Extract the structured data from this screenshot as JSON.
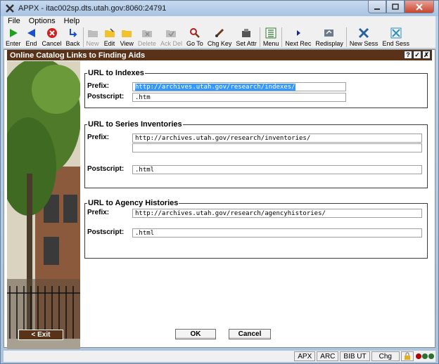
{
  "window": {
    "title": "APPX - itac002sp.dts.utah.gov:8060:24791"
  },
  "menu": [
    "File",
    "Options",
    "Help"
  ],
  "toolbar": {
    "groups": [
      [
        {
          "label": "Enter",
          "icon": "enter-icon",
          "enabled": true
        },
        {
          "label": "End",
          "icon": "end-icon",
          "enabled": true
        },
        {
          "label": "Cancel",
          "icon": "cancel-icon",
          "enabled": true
        },
        {
          "label": "Back",
          "icon": "back-icon",
          "enabled": true
        }
      ],
      [
        {
          "label": "New",
          "icon": "new-folder-icon",
          "enabled": false
        },
        {
          "label": "Edit",
          "icon": "edit-folder-icon",
          "enabled": true
        },
        {
          "label": "View",
          "icon": "view-folder-icon",
          "enabled": true
        },
        {
          "label": "Delete",
          "icon": "delete-folder-icon",
          "enabled": false
        },
        {
          "label": "Ack Del",
          "icon": "ack-delete-icon",
          "enabled": false
        },
        {
          "label": "Go To",
          "icon": "magnifier-icon",
          "enabled": true
        },
        {
          "label": "Chg Key",
          "icon": "change-key-icon",
          "enabled": true
        },
        {
          "label": "Set Attr",
          "icon": "set-attributes-icon",
          "enabled": true
        }
      ],
      [
        {
          "label": "Menu",
          "icon": "menu-icon",
          "enabled": true
        }
      ],
      [
        {
          "label": "Next Rec",
          "icon": "next-record-icon",
          "enabled": true
        },
        {
          "label": "Redisplay",
          "icon": "redisplay-icon",
          "enabled": true
        }
      ],
      [
        {
          "label": "New Sess",
          "icon": "new-session-icon",
          "enabled": true
        },
        {
          "label": "End Sess",
          "icon": "end-session-icon",
          "enabled": true
        }
      ]
    ]
  },
  "form": {
    "title": "Online Catalog Links to Finding Aids",
    "header_buttons": [
      "?",
      "✓",
      "✗"
    ],
    "indexes": {
      "legend": "URL to Indexes",
      "prefix_label": "Prefix:",
      "prefix_value": "http://archives.utah.gov/research/indexes/",
      "postscript_label": "Postscript:",
      "postscript_value": ".htm"
    },
    "inventories": {
      "legend": "URL to Series Inventories",
      "prefix_label": "Prefix:",
      "prefix_value": "http://archives.utah.gov/research/inventories/",
      "prefix_value_2": "",
      "postscript_label": "Postscript:",
      "postscript_value": ".html"
    },
    "histories": {
      "legend": "URL to Agency Histories",
      "prefix_label": "Prefix:",
      "prefix_value": "http://archives.utah.gov/research/agencyhistories/",
      "postscript_label": "Postscript:",
      "postscript_value": ".html"
    },
    "exit_label": "< Exit",
    "ok_label": "OK",
    "cancel_label": "Cancel"
  },
  "status": {
    "cells": [
      "APX",
      "ARC",
      "BIB UT",
      "Chg"
    ],
    "lights": [
      "#b00000",
      "#2f6f2f",
      "#2f6f2f"
    ]
  }
}
